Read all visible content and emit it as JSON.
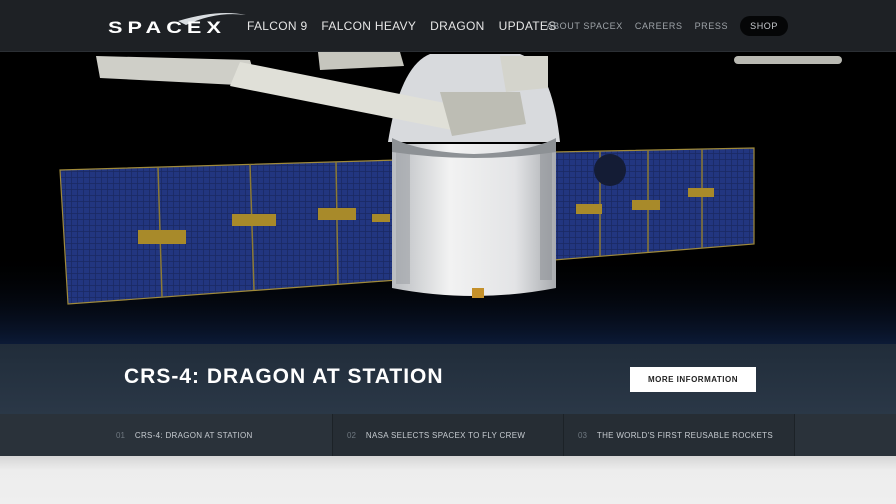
{
  "header": {
    "logo_text": "SPACEX",
    "nav_main": [
      "FALCON 9",
      "FALCON HEAVY",
      "DRAGON",
      "UPDATES"
    ],
    "nav_right": [
      "ABOUT SPACEX",
      "CAREERS",
      "PRESS"
    ],
    "shop_label": "SHOP"
  },
  "hero": {
    "image": "dragon-capsule-solar-arrays-iss-arm-photo"
  },
  "caption": {
    "title": "CRS-4: DRAGON AT STATION",
    "button_label": "MORE INFORMATION"
  },
  "tabs": [
    {
      "num": "01",
      "label": "CRS-4: DRAGON AT STATION"
    },
    {
      "num": "02",
      "label": "NASA SELECTS SPACEX TO FLY CREW"
    },
    {
      "num": "03",
      "label": "THE WORLD'S FIRST REUSABLE ROCKETS"
    }
  ],
  "colors": {
    "header_bg": "#1e2125",
    "caption_bg": "#2c3a4a",
    "tabs_bg": "#2a323a",
    "button_bg": "#ffffff"
  }
}
